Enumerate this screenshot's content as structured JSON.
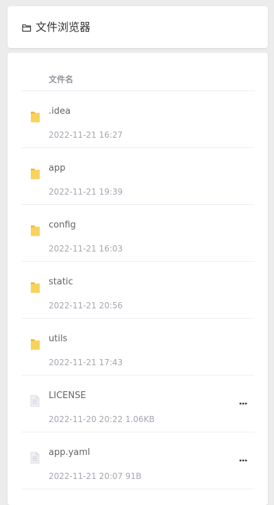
{
  "header": {
    "title": "文件浏览器",
    "icon": "folder-outline-icon"
  },
  "table": {
    "column_name": "文件名"
  },
  "files": [
    {
      "name": ".idea",
      "type": "folder",
      "modified": "2022-11-21 16:27",
      "size": ""
    },
    {
      "name": "app",
      "type": "folder",
      "modified": "2022-11-21 19:39",
      "size": ""
    },
    {
      "name": "config",
      "type": "folder",
      "modified": "2022-11-21 16:03",
      "size": ""
    },
    {
      "name": "static",
      "type": "folder",
      "modified": "2022-11-21 20:56",
      "size": ""
    },
    {
      "name": "utils",
      "type": "folder",
      "modified": "2022-11-21 17:43",
      "size": ""
    },
    {
      "name": "LICENSE",
      "type": "file",
      "modified": "2022-11-20 20:22",
      "size": "1.06KB"
    },
    {
      "name": "app.yaml",
      "type": "file",
      "modified": "2022-11-21 20:07",
      "size": "91B"
    }
  ],
  "colors": {
    "folder": "#f7c84a",
    "file": "#dcdfe6",
    "border": "#ebeef5"
  }
}
